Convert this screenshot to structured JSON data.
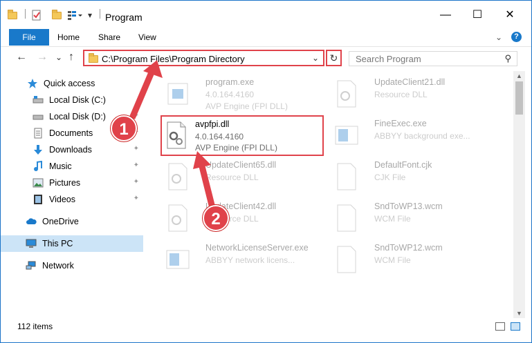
{
  "window": {
    "title": "Program",
    "minimize": "—",
    "maximize": "☐",
    "close": "✕"
  },
  "ribbon": {
    "tabs": [
      {
        "label": "File"
      },
      {
        "label": "Home"
      },
      {
        "label": "Share"
      },
      {
        "label": "View"
      }
    ],
    "expand": "⌄",
    "help": "?"
  },
  "nav": {
    "back": "←",
    "forward": "→",
    "recent": "⌄",
    "up": "↑"
  },
  "address": {
    "path": "C:\\Program Files\\Program Directory",
    "dropdown": "⌄",
    "refresh": "↻"
  },
  "search": {
    "placeholder": "Search Program",
    "icon": "⚲"
  },
  "sidebar": {
    "items": [
      {
        "label": "Quick access",
        "icon": "star-icon"
      },
      {
        "label": "Local Disk (C:)",
        "icon": "drive-icon"
      },
      {
        "label": "Local Disk (D:)",
        "icon": "drive-icon"
      },
      {
        "label": "Documents",
        "icon": "documents-icon"
      },
      {
        "label": "Downloads",
        "icon": "downloads-icon"
      },
      {
        "label": "Music",
        "icon": "music-icon"
      },
      {
        "label": "Pictures",
        "icon": "pictures-icon"
      },
      {
        "label": "Videos",
        "icon": "videos-icon"
      },
      {
        "label": "OneDrive",
        "icon": "cloud-icon"
      },
      {
        "label": "This PC",
        "icon": "computer-icon"
      },
      {
        "label": "Network",
        "icon": "network-icon"
      }
    ],
    "pin": "📌"
  },
  "files": [
    {
      "name": "program.exe",
      "version": "4.0.164.4160",
      "desc": "AVP Engine (FPI DLL)"
    },
    {
      "name": "UpdateClient21.dll",
      "version": "",
      "desc": "Resource DLL"
    },
    {
      "name": "avpfpi.dll",
      "version": "4.0.164.4160",
      "desc": "AVP Engine (FPI DLL)"
    },
    {
      "name": "FineExec.exe",
      "version": "",
      "desc": "ABBYY background exe..."
    },
    {
      "name": "UpdateClient65.dll",
      "version": "",
      "desc": "Resource DLL"
    },
    {
      "name": "DefaultFont.cjk",
      "version": "",
      "desc": "CJK File"
    },
    {
      "name": "UpdateClient42.dll",
      "version": "",
      "desc": "Resource DLL"
    },
    {
      "name": "SndToWP13.wcm",
      "version": "",
      "desc": "WCM File"
    },
    {
      "name": "NetworkLicenseServer.exe",
      "version": "",
      "desc": "ABBYY network licens..."
    },
    {
      "name": "SndToWP12.wcm",
      "version": "",
      "desc": "WCM File"
    }
  ],
  "status": {
    "count": "112 items"
  },
  "callouts": [
    "1",
    "2"
  ],
  "colors": {
    "accent": "#1979ca",
    "highlight": "#e0424a",
    "selected": "#cce4f7"
  }
}
